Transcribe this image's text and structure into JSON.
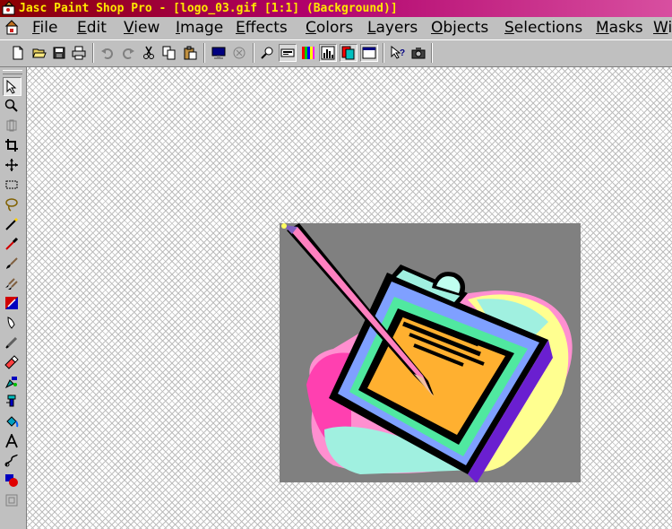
{
  "window": {
    "title": "Jasc Paint Shop Pro - [logo_03.gif [1:1] (Background)]"
  },
  "menubar": {
    "items": [
      {
        "u": "F",
        "rest": "ile"
      },
      {
        "u": "E",
        "rest": "dit"
      },
      {
        "u": "V",
        "rest": "iew"
      },
      {
        "u": "I",
        "rest": "mage"
      },
      {
        "u": "E",
        "rest": "ffects"
      },
      {
        "u": "C",
        "rest": "olors"
      },
      {
        "u": "L",
        "rest": "ayers"
      },
      {
        "u": "O",
        "rest": "bjects"
      },
      {
        "u": "S",
        "rest": "elections"
      },
      {
        "u": "M",
        "rest": "asks"
      },
      {
        "u": "W",
        "rest": "i"
      }
    ]
  },
  "toolbar": {
    "buttons": [
      "new-file-icon",
      "open-folder-icon",
      "save-icon",
      "print-icon",
      "undo-icon",
      "redo-icon",
      "cut-icon",
      "copy-icon",
      "paste-icon",
      "full-screen-preview-icon",
      "normal-viewing-icon",
      "overview-window-icon",
      "tool-options-icon",
      "color-palette-icon",
      "histogram-icon",
      "layer-palette-icon",
      "toggle-palette-icon",
      "context-help-icon",
      "camera-icon"
    ]
  },
  "tools": [
    "arrow-tool-icon",
    "zoom-tool-icon",
    "deformation-tool-icon",
    "crop-tool-icon",
    "mover-tool-icon",
    "selection-tool-icon",
    "freehand-lasso-icon",
    "magic-wand-icon",
    "dropper-icon",
    "paintbrush-icon",
    "clone-brush-icon",
    "color-replacer-icon",
    "retouch-icon",
    "scratch-remover-icon",
    "eraser-icon",
    "picture-tube-icon",
    "airbrush-icon",
    "flood-fill-icon",
    "text-tool-icon",
    "draw-line-icon",
    "preset-shapes-icon",
    "object-selector-icon"
  ],
  "image": {
    "description_name": "clipboard-with-pencil-clipart",
    "background_color": "#808080"
  }
}
